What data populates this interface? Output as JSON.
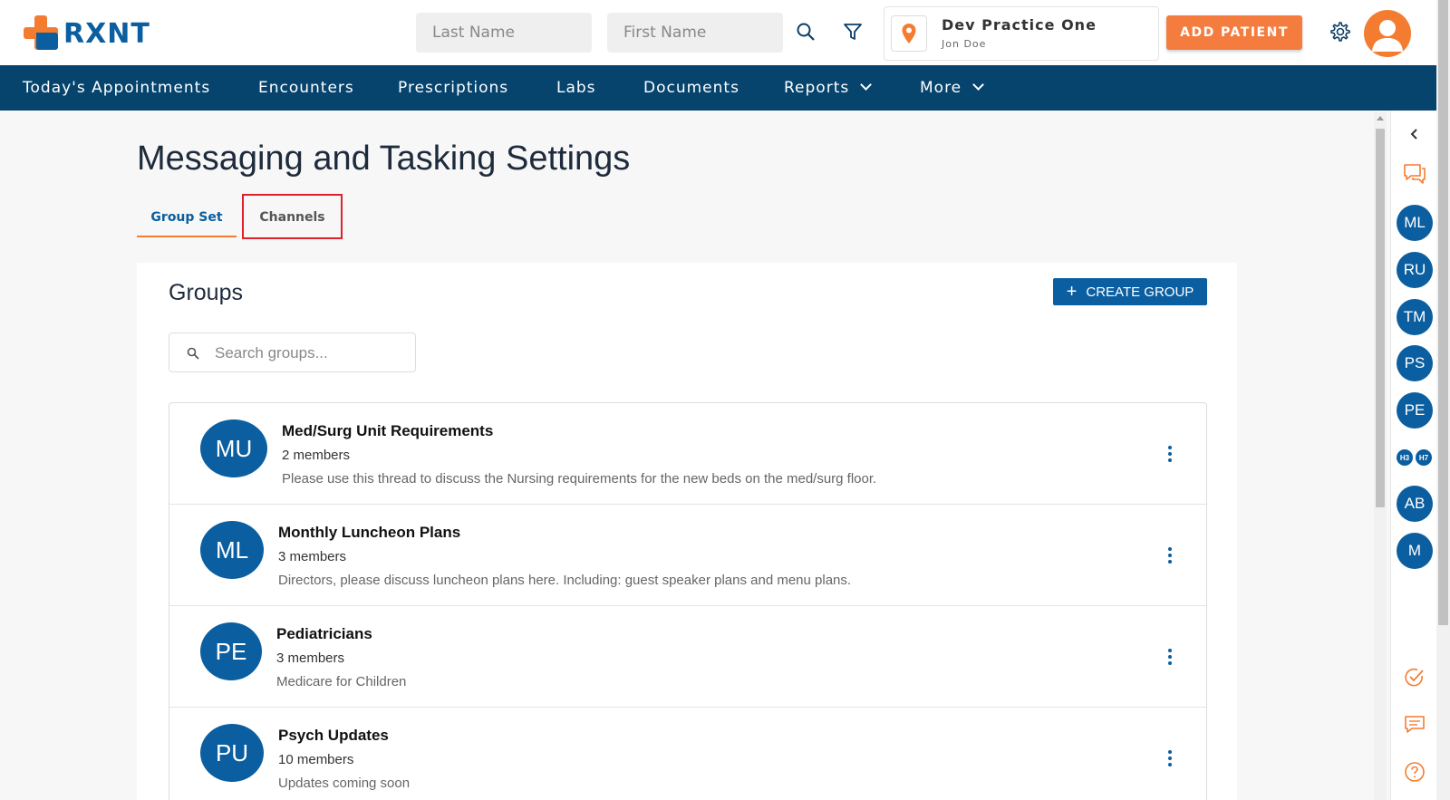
{
  "header": {
    "logo_text": "RXNT",
    "last_name_placeholder": "Last Name",
    "first_name_placeholder": "First Name",
    "practice_name": "Dev Practice One",
    "practice_user": "Jon Doe",
    "add_patient_label": "ADD PATIENT"
  },
  "nav": {
    "items": [
      {
        "label": "Today's Appointments"
      },
      {
        "label": "Encounters"
      },
      {
        "label": "Prescriptions"
      },
      {
        "label": "Labs"
      },
      {
        "label": "Documents"
      },
      {
        "label": "Reports"
      },
      {
        "label": "More"
      }
    ]
  },
  "main": {
    "title": "Messaging and Tasking Settings",
    "tabs": [
      {
        "label": "Group Set",
        "active": true
      },
      {
        "label": "Channels",
        "active": false
      }
    ],
    "panel": {
      "title": "Groups",
      "create_label": "CREATE GROUP",
      "search_placeholder": "Search groups...",
      "groups": [
        {
          "initials": "MU",
          "name": "Med/Surg Unit Requirements",
          "members": "2 members",
          "description": "Please use this thread to discuss the Nursing requirements for the new beds on the med/surg floor."
        },
        {
          "initials": "ML",
          "name": "Monthly Luncheon Plans",
          "members": "3 members",
          "description": "Directors, please discuss luncheon plans here. Including: guest speaker plans and menu plans."
        },
        {
          "initials": "PE",
          "name": "Pediatricians",
          "members": "3 members",
          "description": "Medicare for Children"
        },
        {
          "initials": "PU",
          "name": "Psych Updates",
          "members": "10 members",
          "description": "Updates coming soon"
        }
      ]
    }
  },
  "sidebar": {
    "avatars": [
      "ML",
      "RU",
      "TM",
      "PS",
      "PE"
    ],
    "mini": [
      "H3",
      "H7"
    ],
    "avatars_bottom": [
      "AB",
      "M"
    ]
  },
  "colors": {
    "brand_blue": "#0b5fa0",
    "nav_blue": "#06446e",
    "accent_orange": "#f47c3f"
  }
}
